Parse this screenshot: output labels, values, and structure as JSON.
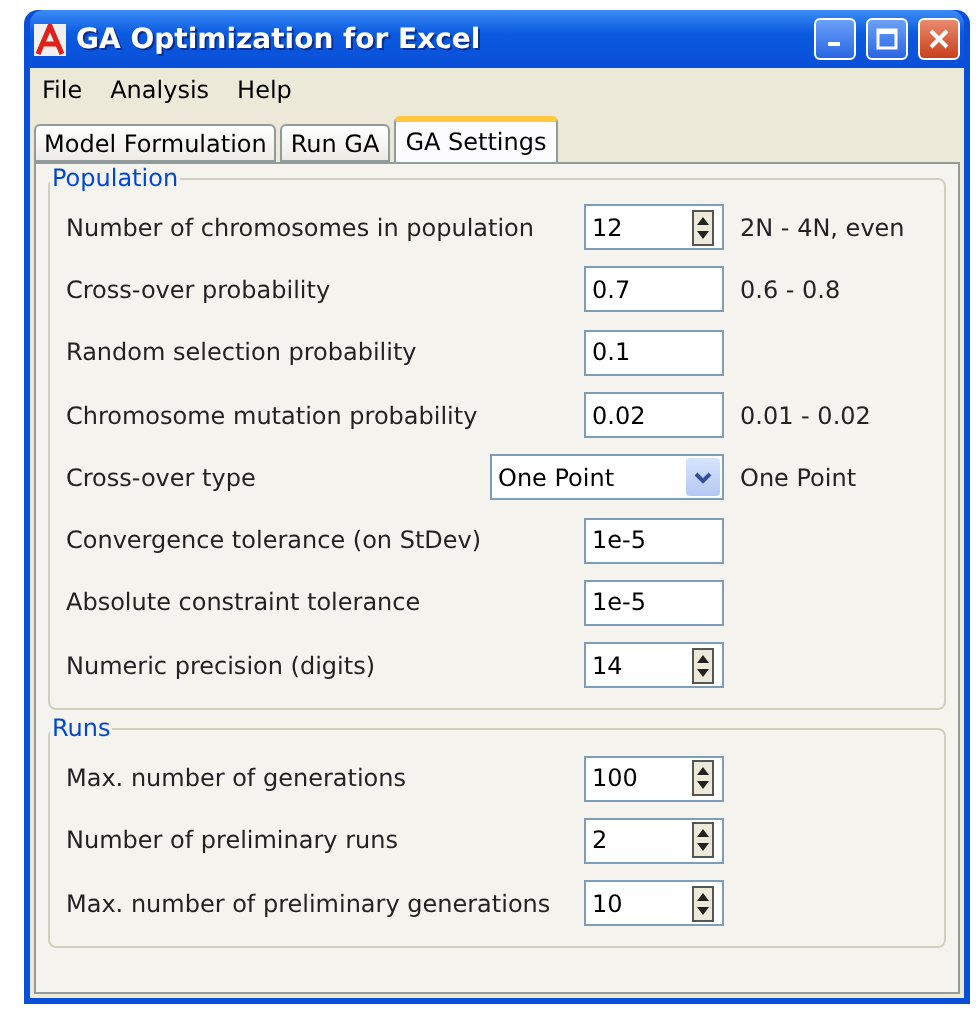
{
  "window": {
    "title": "GA Optimization for Excel"
  },
  "menu": [
    "File",
    "Analysis",
    "Help"
  ],
  "tabs": [
    {
      "label": "Model Formulation",
      "selected": false
    },
    {
      "label": "Run GA",
      "selected": false
    },
    {
      "label": "GA Settings",
      "selected": true
    }
  ],
  "groups": [
    {
      "title": "Population",
      "rows": [
        {
          "label": "Number of chromosomes in population",
          "kind": "spin",
          "value": "12",
          "hint": "2N - 4N, even"
        },
        {
          "label": "Cross-over probability",
          "kind": "text",
          "value": "0.7",
          "hint": "0.6 - 0.8"
        },
        {
          "label": "Random selection probability",
          "kind": "text",
          "value": "0.1"
        },
        {
          "label": "Chromosome mutation probability",
          "kind": "text",
          "value": "0.02",
          "hint": "0.01 - 0.02"
        },
        {
          "label": "Cross-over type",
          "kind": "combo",
          "value": "One Point",
          "hint": "One Point"
        },
        {
          "label": "Convergence tolerance (on StDev)",
          "kind": "text",
          "value": "1e-5"
        },
        {
          "label": "Absolute constraint tolerance",
          "kind": "text",
          "value": "1e-5"
        },
        {
          "label": "Numeric precision (digits)",
          "kind": "spin",
          "value": "14"
        }
      ]
    },
    {
      "title": "Runs",
      "rows": [
        {
          "label": "Max. number of generations",
          "kind": "spin",
          "value": "100"
        },
        {
          "label": "Number of preliminary runs",
          "kind": "spin",
          "value": "2"
        },
        {
          "label": "Max. number of preliminary generations",
          "kind": "spin",
          "value": "10"
        }
      ]
    }
  ]
}
